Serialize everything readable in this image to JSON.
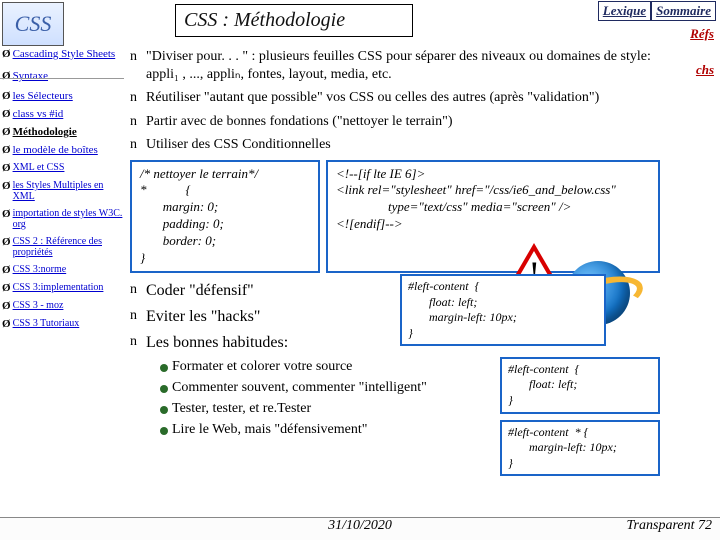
{
  "header": {
    "title": "CSS : Méthodologie",
    "logo_text": "CSS",
    "top_links": {
      "lexique": "Lexique",
      "sommaire": "Sommaire"
    },
    "refs": "Réfs",
    "techs": "chs"
  },
  "sidebar": [
    {
      "label": "Cascading Style Sheets"
    },
    {
      "label": "Syntaxe"
    },
    {
      "label": "les Sélecteurs"
    },
    {
      "label": "class vs #id"
    },
    {
      "label": "Méthodologie",
      "current": true
    },
    {
      "label": "le modèle de boîtes"
    },
    {
      "label": "XML et CSS"
    },
    {
      "label": "les Styles Multiples en XML"
    },
    {
      "label": "importation de styles W3C. org"
    },
    {
      "label": "CSS 2 : Référence des propriétés"
    },
    {
      "label": "CSS 3:norme"
    },
    {
      "label": "CSS 3:implementation"
    },
    {
      "label": "CSS 3 - moz"
    },
    {
      "label": "CSS 3 Tutoriaux"
    }
  ],
  "points": [
    "\"Diviser pour. . . \" : plusieurs feuilles CSS pour séparer des niveaux ou domaines de style: appli₁ , ..., appliₙ, fontes, layout, media, etc.",
    "Réutiliser \"autant que possible\" vos CSS ou celles des autres (après \"validation\")",
    "Partir avec de bonnes fondations (\"nettoyer le terrain\")",
    "Utiliser des CSS Conditionnelles"
  ],
  "code": {
    "reset": "/* nettoyer le terrain*/\n*            {\n       margin: 0;\n       padding: 0;\n       border: 0;\n}",
    "cond": "<!--[if lte IE 6]>\n<link rel=\"stylesheet\" href=\"/css/ie6_and_below.css\"\n                type=\"text/css\" media=\"screen\" />\n<![endif]-->",
    "mid": "#left-content  {\n       float: left;\n       margin-left: 10px;\n}",
    "fix1": "#left-content  {\n       float: left;\n}",
    "fix2": "#left-content  * {\n       margin-left: 10px;\n}"
  },
  "points2": [
    "Coder \"défensif\"",
    "Eviter les \"hacks\"",
    "Les bonnes habitudes:"
  ],
  "habits": [
    "Formater et colorer votre source",
    "Commenter souvent, commenter \"intelligent\"",
    "Tester, tester, et re.Tester",
    "Lire le Web, mais  \"défensivement\""
  ],
  "footer": {
    "date": "31/10/2020",
    "page": "Transparent 72"
  }
}
